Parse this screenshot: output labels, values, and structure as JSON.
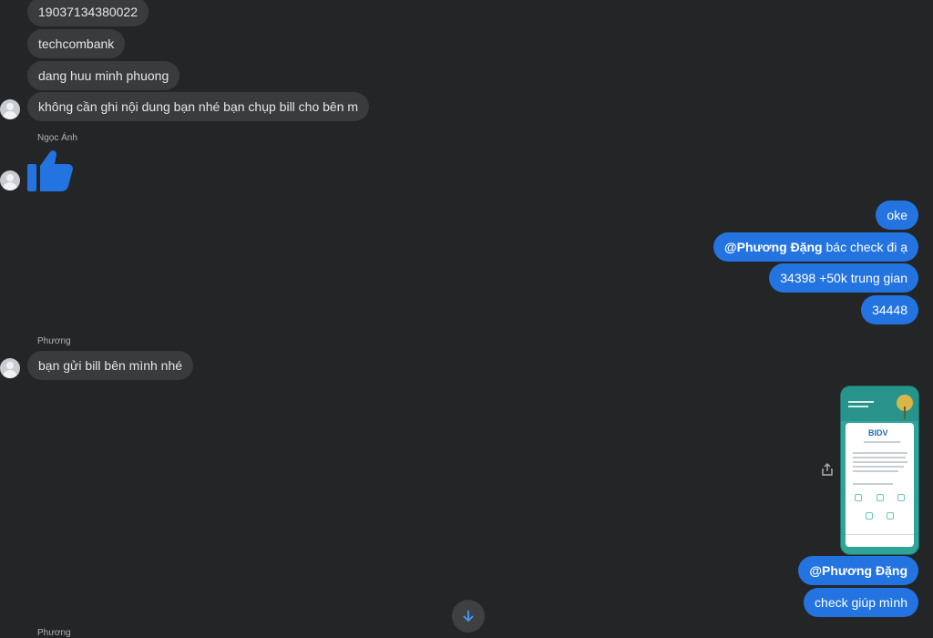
{
  "incoming_group_1": {
    "messages": [
      "19037134380022",
      "techcombank",
      "dang huu minh phuong",
      "không cần ghi nội dung bạn nhé bạn chụp bill cho bên m"
    ]
  },
  "incoming_group_2": {
    "sender": "Ngọc Ánh",
    "reaction_icon": "thumbs-up-icon"
  },
  "outgoing_group_1": {
    "messages": [
      {
        "text": "oke"
      },
      {
        "mention": "@Phương Đặng",
        "text": " bác check đi ạ"
      },
      {
        "text": "34398 +50k trung gian"
      },
      {
        "text": "34448"
      }
    ]
  },
  "incoming_group_3": {
    "sender": "Phương",
    "messages": [
      "bạn gửi bill bên mình nhé"
    ]
  },
  "outgoing_group_2": {
    "image": {
      "bank_name": "BIDV",
      "icon": "receipt-screenshot-icon"
    },
    "share_icon": "share-icon",
    "messages": [
      {
        "mention": "@Phương Đặng"
      },
      {
        "text": "check giúp mình"
      }
    ]
  },
  "footer": {
    "next_sender": "Phương",
    "scroll_icon": "arrow-down-icon"
  },
  "colors": {
    "background": "#242526",
    "incoming_bubble": "#3a3b3c",
    "outgoing_bubble": "#2374e1",
    "like_blue": "#2374e1"
  }
}
